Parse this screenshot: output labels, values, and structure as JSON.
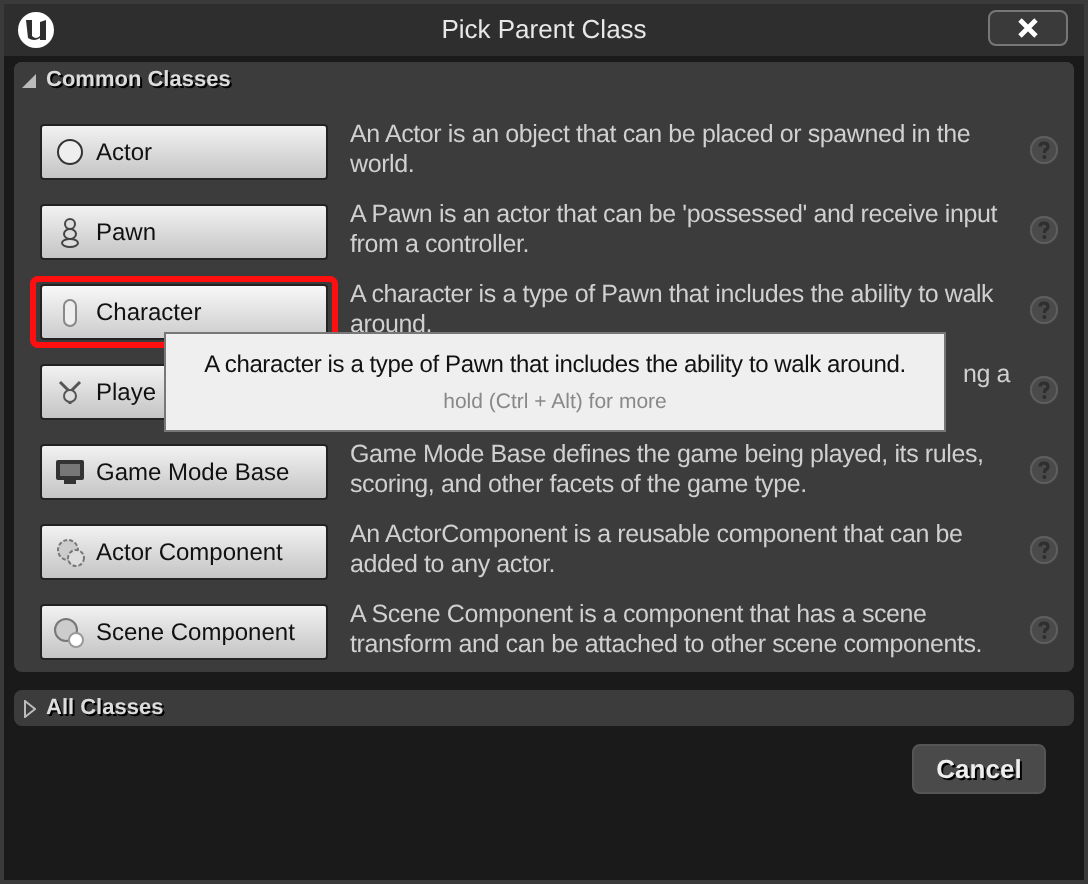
{
  "window": {
    "title": "Pick Parent Class"
  },
  "common_classes": {
    "title": "Common Classes",
    "expanded": true,
    "items": [
      {
        "label": "Actor",
        "description": "An Actor is an object that can be placed or spawned in the world.",
        "selected": false
      },
      {
        "label": "Pawn",
        "description": "A Pawn is an actor that can be 'possessed' and receive input from a controller.",
        "selected": false
      },
      {
        "label": "Character",
        "description": "A character is a type of Pawn that includes the ability to walk around.",
        "selected": true
      },
      {
        "label": "Playe",
        "description": "ng a",
        "selected": false
      },
      {
        "label": "Game Mode Base",
        "description": "Game Mode Base defines the game being played, its rules, scoring, and other facets of the game type.",
        "selected": false
      },
      {
        "label": "Actor Component",
        "description": "An ActorComponent is a reusable component that can be added to any actor.",
        "selected": false
      },
      {
        "label": "Scene Component",
        "description": "A Scene Component is a component that has a scene transform and can be attached to other scene components.",
        "selected": false
      }
    ]
  },
  "all_classes": {
    "title": "All Classes",
    "expanded": false
  },
  "tooltip": {
    "text": "A character is a type of Pawn that includes the ability to walk around.",
    "hint": "hold (Ctrl + Alt) for more"
  },
  "buttons": [
    "Cancel"
  ]
}
